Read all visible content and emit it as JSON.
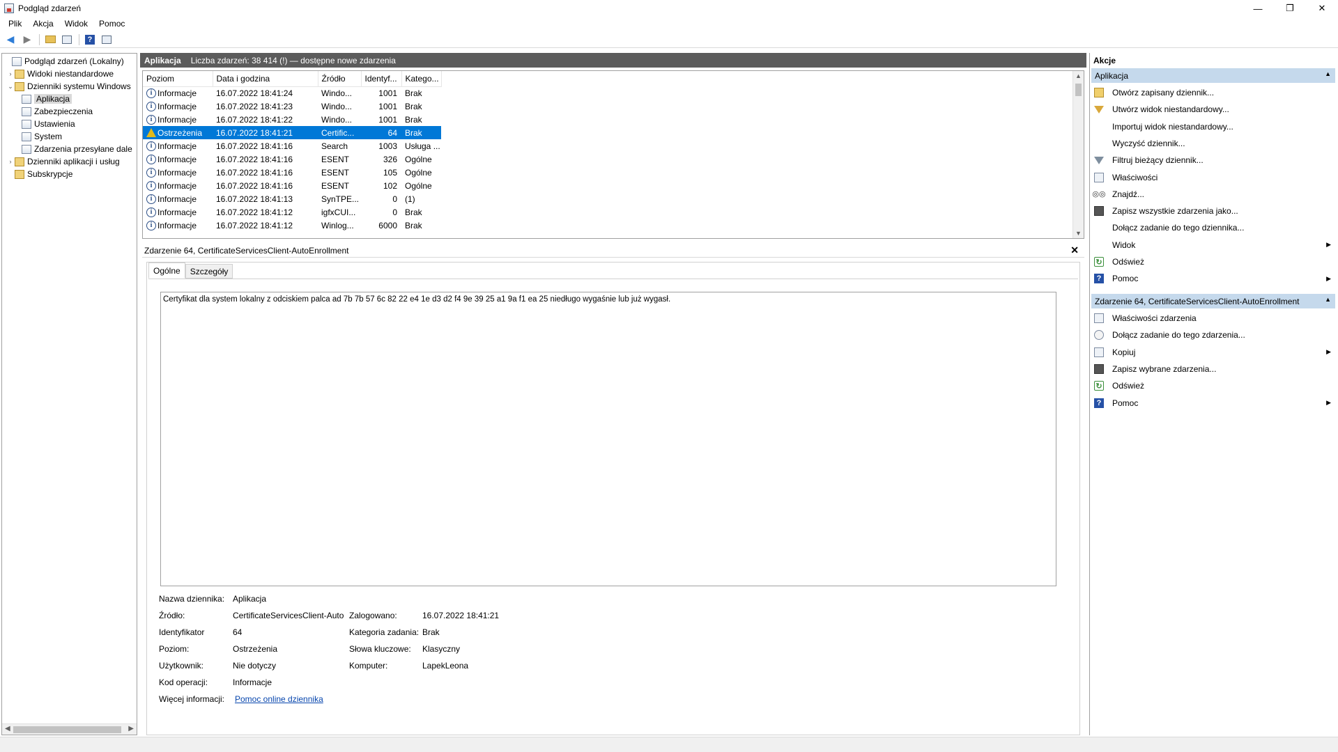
{
  "window": {
    "title": "Podgląd zdarzeń",
    "minimize": "—",
    "restore": "❐",
    "close": "✕"
  },
  "menu": [
    "Plik",
    "Akcja",
    "Widok",
    "Pomoc"
  ],
  "toolbar": {
    "icons": [
      "back-arrow-icon",
      "forward-arrow-icon",
      "open-folder-icon",
      "console-tree-icon",
      "help-icon",
      "action-pane-icon"
    ]
  },
  "tree": {
    "items": [
      {
        "label": "Podgląd zdarzeń (Lokalny)",
        "expander": ""
      },
      {
        "label": "Widoki niestandardowe",
        "expander": "›"
      },
      {
        "label": "Dzienniki systemu Windows",
        "expander": "⌄"
      },
      {
        "label": "Aplikacja",
        "expander": ""
      },
      {
        "label": "Zabezpieczenia",
        "expander": ""
      },
      {
        "label": "Ustawienia",
        "expander": ""
      },
      {
        "label": "System",
        "expander": ""
      },
      {
        "label": "Zdarzenia przesyłane dale",
        "expander": ""
      },
      {
        "label": "Dzienniki aplikacji i usług",
        "expander": "›"
      },
      {
        "label": "Subskrypcje",
        "expander": ""
      }
    ],
    "selected": "Aplikacja"
  },
  "center": {
    "header_name": "Aplikacja",
    "header_info": "Liczba zdarzeń: 38 414 (!) — dostępne nowe zdarzenia",
    "columns": [
      "Poziom",
      "Data i godzina",
      "Źródło",
      "Identyf...",
      "Katego..."
    ],
    "rows": [
      {
        "level": "Informacje",
        "date": "16.07.2022 18:41:24",
        "source": "Windo...",
        "id": "1001",
        "category": "Brak"
      },
      {
        "level": "Informacje",
        "date": "16.07.2022 18:41:23",
        "source": "Windo...",
        "id": "1001",
        "category": "Brak"
      },
      {
        "level": "Informacje",
        "date": "16.07.2022 18:41:22",
        "source": "Windo...",
        "id": "1001",
        "category": "Brak"
      },
      {
        "level": "Ostrzeżenia",
        "date": "16.07.2022 18:41:21",
        "source": "Certific...",
        "id": "64",
        "category": "Brak"
      },
      {
        "level": "Informacje",
        "date": "16.07.2022 18:41:16",
        "source": "Search",
        "id": "1003",
        "category": "Usługa ..."
      },
      {
        "level": "Informacje",
        "date": "16.07.2022 18:41:16",
        "source": "ESENT",
        "id": "326",
        "category": "Ogólne"
      },
      {
        "level": "Informacje",
        "date": "16.07.2022 18:41:16",
        "source": "ESENT",
        "id": "105",
        "category": "Ogólne"
      },
      {
        "level": "Informacje",
        "date": "16.07.2022 18:41:16",
        "source": "ESENT",
        "id": "102",
        "category": "Ogólne"
      },
      {
        "level": "Informacje",
        "date": "16.07.2022 18:41:13",
        "source": "SynTPE...",
        "id": "0",
        "category": "(1)"
      },
      {
        "level": "Informacje",
        "date": "16.07.2022 18:41:12",
        "source": "igfxCUI...",
        "id": "0",
        "category": "Brak"
      },
      {
        "level": "Informacje",
        "date": "16.07.2022 18:41:12",
        "source": "Winlog...",
        "id": "6000",
        "category": "Brak"
      }
    ],
    "selected_row": 3
  },
  "detail": {
    "title": "Zdarzenie 64, CertificateServicesClient-AutoEnrollment",
    "close": "✕",
    "tabs": [
      "Ogólne",
      "Szczegóły"
    ],
    "message": "Certyfikat dla system lokalny z odciskiem palca ad 7b 7b 57 6c 82 22 e4 1e d3 d2 f4 9e 39 25 a1 9a f1 ea 25 niedługo wygaśnie lub już wygasł.",
    "fields": {
      "log_name_label": "Nazwa dziennika:",
      "log_name": "Aplikacja",
      "source_label": "Źródło:",
      "source": "CertificateServicesClient-Auto",
      "logged_label": "Zalogowano:",
      "logged": "16.07.2022 18:41:21",
      "id_label": "Identyfikator",
      "id": "64",
      "task_label": "Kategoria zadania:",
      "task": "Brak",
      "level_label": "Poziom:",
      "level": "Ostrzeżenia",
      "keywords_label": "Słowa kluczowe:",
      "keywords": "Klasyczny",
      "user_label": "Użytkownik:",
      "user": "Nie dotyczy",
      "computer_label": "Komputer:",
      "computer": "LapekLeona",
      "opcode_label": "Kod operacji:",
      "opcode": "Informacje",
      "more_label": "Więcej informacji:",
      "more_link": "Pomoc online dziennika"
    }
  },
  "actions": {
    "title": "Akcje",
    "section1": "Aplikacja",
    "items1": [
      {
        "label": "Otwórz zapisany dziennik...",
        "icon": "open-log-icon",
        "sub": ""
      },
      {
        "label": "Utwórz widok niestandardowy...",
        "icon": "create-view-icon",
        "sub": ""
      },
      {
        "label": "Importuj widok niestandardowy...",
        "icon": "",
        "sub": ""
      },
      {
        "label": "Wyczyść dziennik...",
        "icon": "",
        "sub": ""
      },
      {
        "label": "Filtruj bieżący dziennik...",
        "icon": "filter-icon",
        "sub": ""
      },
      {
        "label": "Właściwości",
        "icon": "properties-icon",
        "sub": ""
      },
      {
        "label": "Znajdź...",
        "icon": "find-icon",
        "sub": ""
      },
      {
        "label": "Zapisz wszystkie zdarzenia jako...",
        "icon": "save-icon",
        "sub": ""
      },
      {
        "label": "Dołącz zadanie do tego dziennika...",
        "icon": "",
        "sub": ""
      },
      {
        "label": "Widok",
        "icon": "",
        "sub": "▶"
      },
      {
        "label": "Odśwież",
        "icon": "refresh-icon",
        "sub": ""
      },
      {
        "label": "Pomoc",
        "icon": "help-icon",
        "sub": "▶"
      }
    ],
    "section2": "Zdarzenie 64, CertificateServicesClient-AutoEnrollment",
    "items2": [
      {
        "label": "Właściwości zdarzenia",
        "icon": "properties-icon",
        "sub": ""
      },
      {
        "label": "Dołącz zadanie do tego zdarzenia...",
        "icon": "task-icon",
        "sub": ""
      },
      {
        "label": "Kopiuj",
        "icon": "copy-icon",
        "sub": "▶"
      },
      {
        "label": "Zapisz wybrane zdarzenia...",
        "icon": "save-icon",
        "sub": ""
      },
      {
        "label": "Odśwież",
        "icon": "refresh-icon",
        "sub": ""
      },
      {
        "label": "Pomoc",
        "icon": "help-icon",
        "sub": "▶"
      }
    ],
    "collapse": "▲"
  },
  "colors": {
    "selection": "#0078d7",
    "header_bar": "#5c5c5c",
    "action_section": "#c5d9ec",
    "warning": "#e2b91b",
    "link": "#0645ad"
  }
}
